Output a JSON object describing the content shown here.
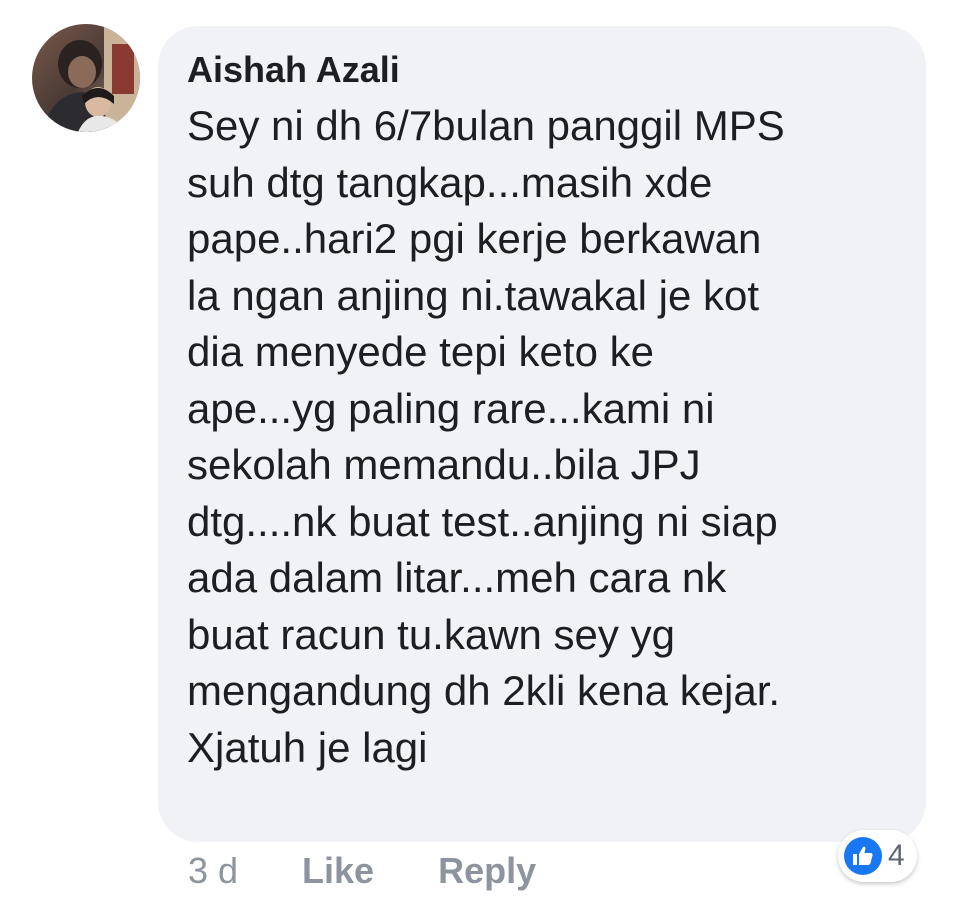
{
  "comment": {
    "author": "Aishah Azali",
    "text_lines": [
      "Sey ni dh 6/7bulan panggil MPS",
      "suh dtg tangkap...masih xde",
      "pape..hari2 pgi kerje berkawan",
      "la ngan anjing ni.tawakal je kot",
      "dia menyede tepi keto ke",
      "ape...yg paling rare...kami ni",
      "sekolah memandu..bila JPJ",
      "dtg....nk buat test..anjing ni siap",
      "ada dalam litar...meh cara nk",
      "buat racun tu.kawn sey yg",
      "mengandung dh 2kli kena kejar.",
      "Xjatuh je lagi"
    ]
  },
  "actions": {
    "timestamp": "3 d",
    "like_label": "Like",
    "reply_label": "Reply"
  },
  "reactions": {
    "icon": "thumbs-up-icon",
    "count": "4"
  },
  "colors": {
    "bubble_background": "#f0f2f5",
    "text": "#1c1e21",
    "muted": "#8d949e",
    "like_blue": "#1877f2"
  }
}
